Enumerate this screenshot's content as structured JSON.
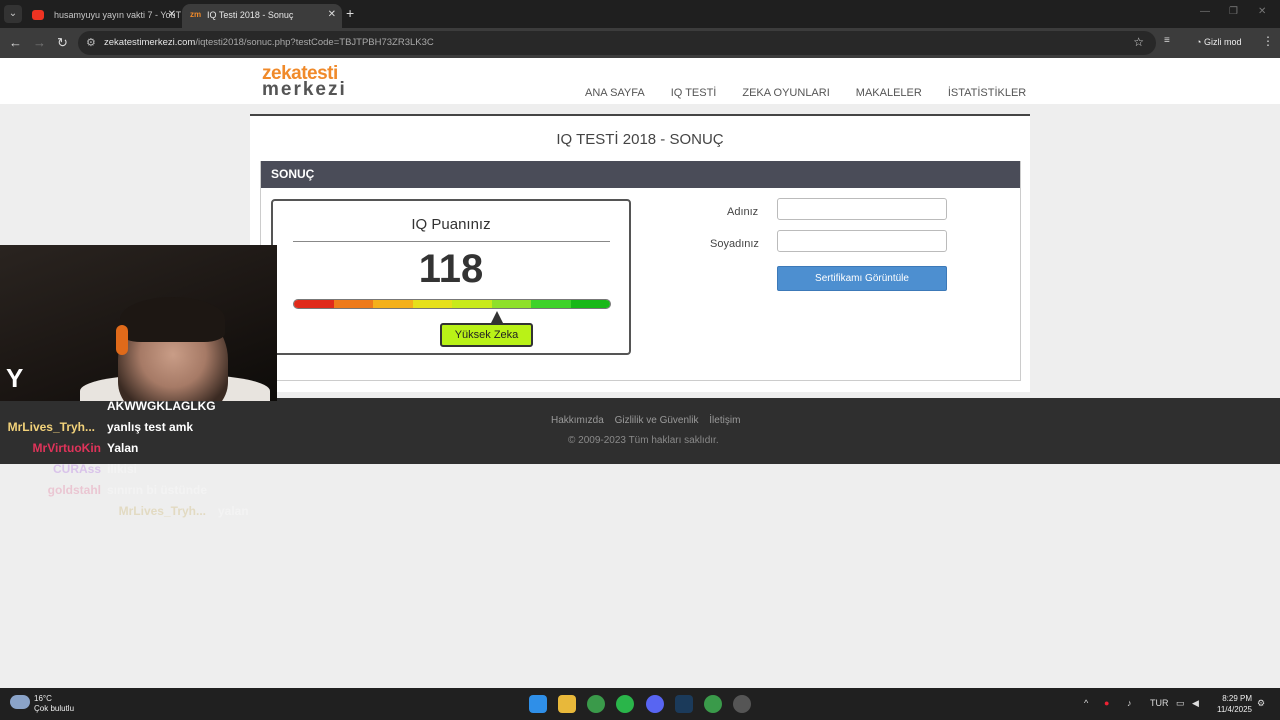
{
  "browser": {
    "tabs": [
      {
        "title": "husamyuyu yayın vakti 7 - YouT",
        "active": false
      },
      {
        "title": "IQ Testi 2018 - Sonuç",
        "active": true
      }
    ],
    "url_host": "zekatestimerkezi.com",
    "url_path": "/iqtesti2018/sonuc.php?testCode=TBJTPBH73ZR3LK3C",
    "incognito_label": "Gizli mod",
    "tab2_favicon": "zm"
  },
  "site": {
    "logo_line1": "zekatesti",
    "logo_line2": "merkezi",
    "nav": [
      "ANA SAYFA",
      "IQ TESTİ",
      "ZEKA OYUNLARI",
      "MAKALELER",
      "İSTATİSTİKLER"
    ]
  },
  "page": {
    "title": "IQ TESTİ 2018 - SONUÇ",
    "section_header": "SONUÇ",
    "iq_label": "IQ Puanınız",
    "iq_score": "118",
    "iq_level": "Yüksek Zeka",
    "gauge_colors": [
      "#e02a1a",
      "#ee7a1a",
      "#f4b01a",
      "#e6e01a",
      "#c8ea1a",
      "#8ee02a",
      "#3ed22a",
      "#18b818"
    ],
    "gauge_position_fraction": 0.64,
    "form": {
      "first_name_label": "Adınız",
      "last_name_label": "Soyadınız",
      "first_name_value": "",
      "last_name_value": "",
      "certificate_button": "Sertifikamı Görüntüle"
    }
  },
  "footer": {
    "links": [
      "Hakkımızda",
      "Gizlilik ve Güvenlik",
      "İletişim"
    ],
    "copyright": "© 2009-2023 Tüm hakları saklıdır."
  },
  "chat": [
    {
      "user": "",
      "message": "AKWWGKLAGLKG",
      "user_color": "#ffffff",
      "faded": false
    },
    {
      "user": "MrLives_Tryh...",
      "message": "yanlış test amk",
      "user_color": "#f2d27a",
      "faded": false
    },
    {
      "user": "MrVirtuoKin",
      "message": "Yalan",
      "user_color": "#e0335a",
      "faded": false
    },
    {
      "user": "CURAss",
      "message": "ilikisi",
      "user_color": "#c8a0e8",
      "faded": true
    },
    {
      "user": "goldstahl",
      "message": "sınırın bi üstünde",
      "user_color": "#e8a0b8",
      "faded": true
    },
    {
      "user": "MrLives_Tryh...",
      "message": "yalan",
      "user_color": "#d8c898",
      "faded": true
    }
  ],
  "taskbar": {
    "temperature": "16°C",
    "weather": "Çok bulutlu",
    "language": "TUR",
    "time": "8:29 PM",
    "date": "11/4/2025"
  }
}
